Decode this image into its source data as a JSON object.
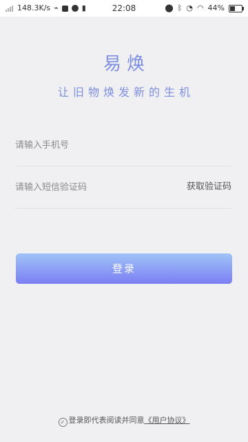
{
  "status_bar": {
    "network_speed": "148.3K/s",
    "time": "22:08",
    "battery_percent": "44%"
  },
  "app": {
    "title": "易焕",
    "slogan": "让旧物焕发新的生机"
  },
  "form": {
    "phone_placeholder": "请输入手机号",
    "code_placeholder": "请输入短信验证码",
    "get_code_label": "获取验证码",
    "login_label": "登录"
  },
  "agreement": {
    "prefix": "登录即代表阅读并同意",
    "link_label": "《用户协议》"
  },
  "colors": {
    "accent": "#7d8fe0",
    "button_gradient_top": "#9fc3f7",
    "button_gradient_bottom": "#7b7ff3",
    "background": "#f0f0f2"
  }
}
